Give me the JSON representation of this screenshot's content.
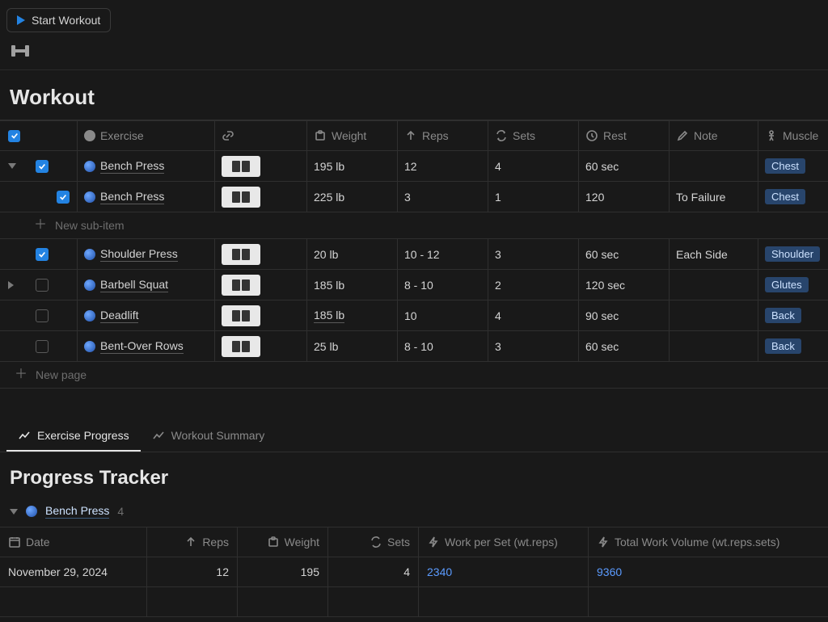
{
  "topbar": {
    "start_label": "Start Workout"
  },
  "section1_title": "Workout",
  "columns": {
    "exercise": "Exercise",
    "link": "",
    "weight": "Weight",
    "reps": "Reps",
    "sets": "Sets",
    "rest": "Rest",
    "note": "Note",
    "muscle": "Muscle"
  },
  "rows": [
    {
      "checked": true,
      "expanded": "down",
      "name": "Bench Press",
      "weight": "195 lb",
      "reps": "12",
      "sets": "4",
      "rest": "60 sec",
      "note": "",
      "muscle": "Chest"
    },
    {
      "checked": true,
      "sub": true,
      "name": "Bench Press",
      "weight": "225 lb",
      "reps": "3",
      "sets": "1",
      "rest": "120",
      "note": "To Failure",
      "muscle": "Chest"
    },
    {
      "checked": true,
      "name": "Shoulder Press",
      "weight": "20 lb",
      "reps": "10 - 12",
      "sets": "3",
      "rest": "60 sec",
      "note": "Each Side",
      "muscle": "Shoulder"
    },
    {
      "checked": false,
      "expanded": "right",
      "name": "Barbell Squat",
      "weight": "185 lb",
      "reps": "8 - 10",
      "sets": "2",
      "rest": "120 sec",
      "note": "",
      "muscle": "Glutes"
    },
    {
      "checked": false,
      "name": "Deadlift",
      "weight": "185 lb",
      "reps": "10",
      "sets": "4",
      "rest": "90 sec",
      "note": "",
      "muscle": "Back"
    },
    {
      "checked": false,
      "name": "Bent-Over Rows",
      "weight": "25 lb",
      "reps": "8 - 10",
      "sets": "3",
      "rest": "60 sec",
      "note": "",
      "muscle": "Back"
    }
  ],
  "new_sub_label": "New sub-item",
  "new_page_label": "New page",
  "tabs": {
    "progress": "Exercise Progress",
    "summary": "Workout Summary"
  },
  "section2_title": "Progress Tracker",
  "group": {
    "name": "Bench Press",
    "count": "4"
  },
  "columns2": {
    "date": "Date",
    "reps": "Reps",
    "weight": "Weight",
    "sets": "Sets",
    "wps": "Work per Set (wt.reps)",
    "twv": "Total Work Volume (wt.reps.sets)"
  },
  "prow": {
    "date": "November 29, 2024",
    "reps": "12",
    "weight": "195",
    "sets": "4",
    "wps": "2340",
    "twv": "9360"
  }
}
